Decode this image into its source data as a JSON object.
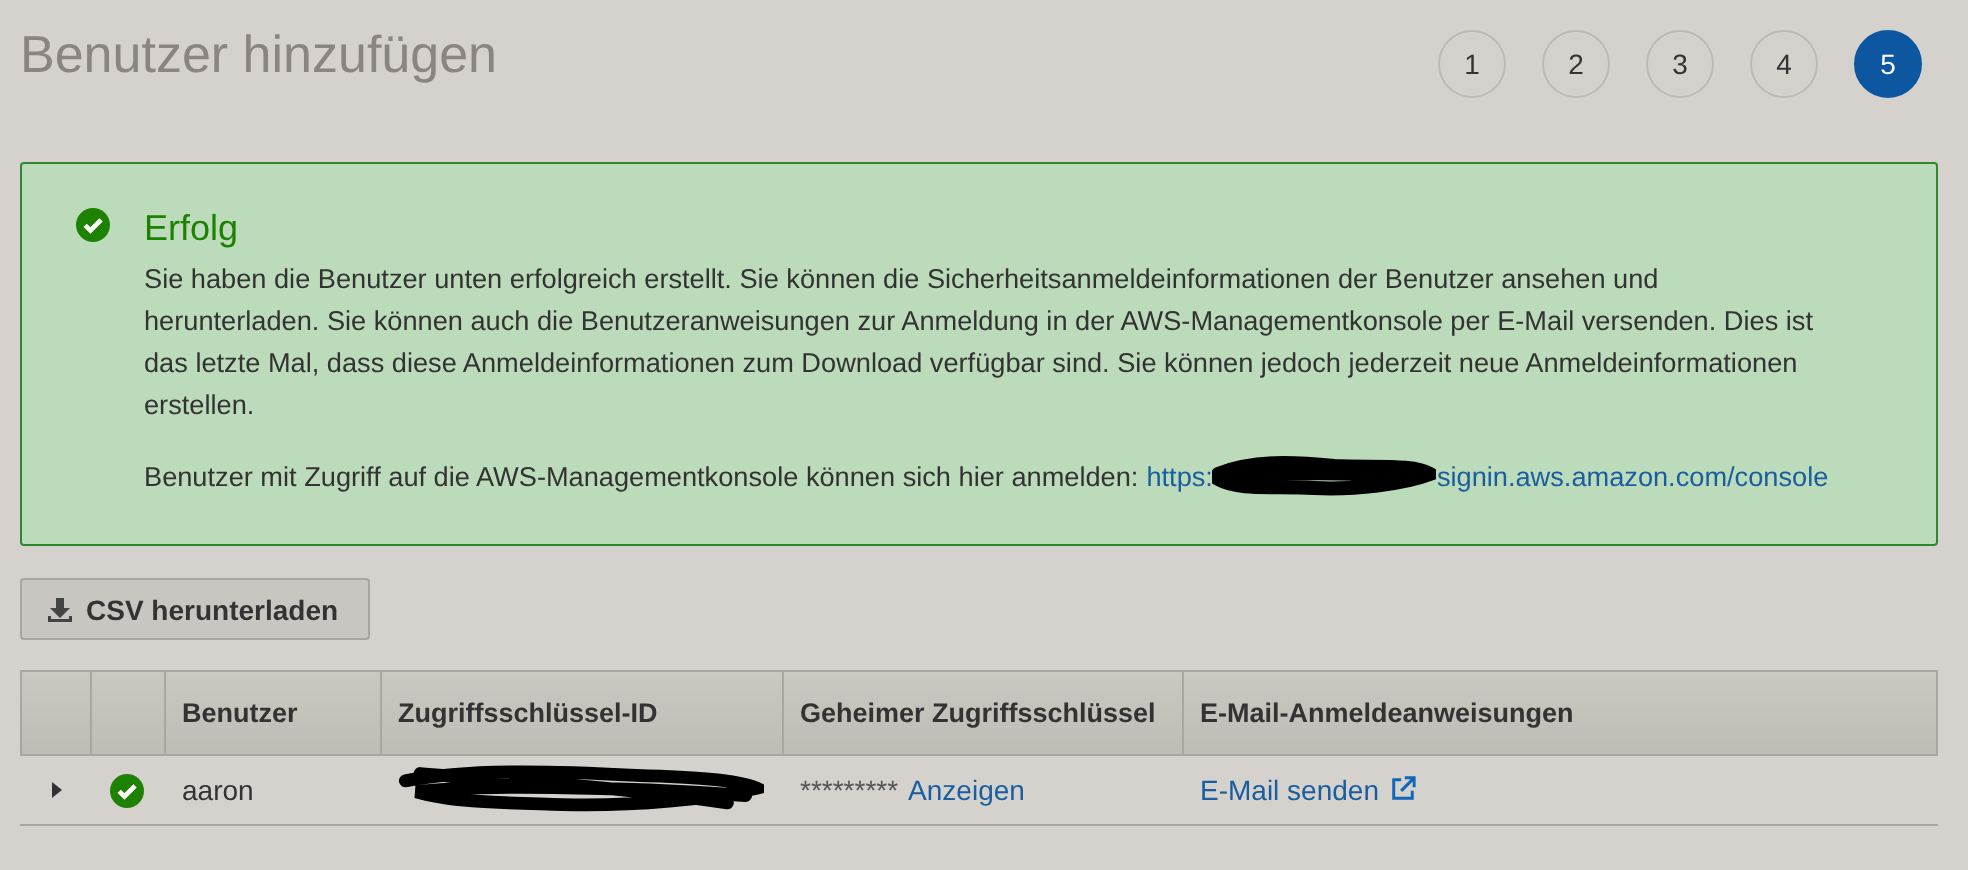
{
  "page_title": "Benutzer hinzufügen",
  "steps": [
    {
      "label": "1",
      "selected": false
    },
    {
      "label": "2",
      "selected": false
    },
    {
      "label": "3",
      "selected": false
    },
    {
      "label": "4",
      "selected": false
    },
    {
      "label": "5",
      "selected": true
    }
  ],
  "alert": {
    "kind": "success",
    "title": "Erfolg",
    "message": "Sie haben die Benutzer unten erfolgreich erstellt. Sie können die Sicherheitsanmeldeinformationen der Benutzer ansehen und herunterladen. Sie können auch die Benutzeranweisungen zur Anmeldung in der AWS-Managementkonsole per E-Mail versenden. Dies ist das letzte Mal, dass diese Anmeldeinformationen zum Download verfügbar sind. Sie können jedoch jederzeit neue Anmeldeinformationen erstellen.",
    "console_text": "Benutzer mit Zugriff auf die AWS-Managementkonsole können sich hier anmelden:",
    "console_link_start": "https:",
    "console_link_end": "signin.aws.amazon.com/console"
  },
  "download_button": "CSV herunterladen",
  "table": {
    "columns": [
      "Benutzer",
      "Zugriffsschlüssel-ID",
      "Geheimer Zugriffsschlüssel",
      "E-Mail-Anmeldeanweisungen"
    ],
    "rows": [
      {
        "expanded": false,
        "kind": "success",
        "user": "aaron",
        "secret": "*********",
        "show_link": "Anzeigen",
        "email_link": "E-Mail senden"
      }
    ]
  }
}
